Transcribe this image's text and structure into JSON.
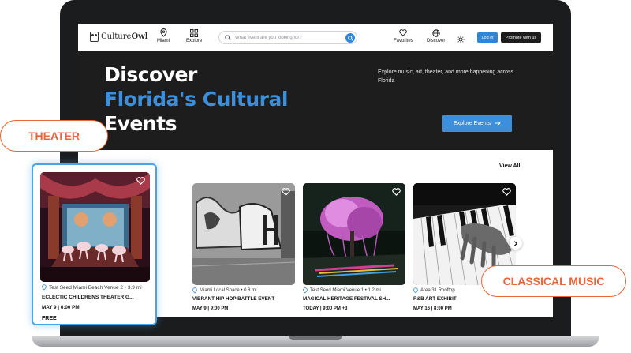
{
  "brand": {
    "prefix": "Culture",
    "suffix": "Owl"
  },
  "nav": {
    "location_label": "Miami",
    "explore_label": "Explore",
    "search_placeholder": "What event are you looking for?",
    "favorites_label": "Favorites",
    "discover_label": "Discover",
    "login_label": "Log in",
    "promote_label": "Promote with us"
  },
  "hero": {
    "line1": "Discover",
    "line2": "Florida's Cultural",
    "line3": "Events",
    "subtitle": "Explore music, art, theater, and more happening across Florida",
    "cta_label": "Explore Events",
    "accent_color": "#3b8fdc"
  },
  "events": {
    "view_all_label": "View All",
    "featured": {
      "venue": "Test Seed Miami Beach Venue 2 • 3.9 mi",
      "title": "ECLECTIC CHILDRENS THEATER G...",
      "date": "MAY 9  |  6:00 PM",
      "price": "FREE"
    },
    "cards": [
      {
        "venue": "Miami Local Space • 0.8 mi",
        "title": "VIBRANT HIP HOP BATTLE EVENT",
        "date": "MAY 9  |  9:00 PM"
      },
      {
        "venue": "Test Seed Miami Venue 1 • 1.2 mi",
        "title": "MAGICAL HERITAGE FESTIVAL SH...",
        "date": "TODAY  |  9:00 PM  +3"
      },
      {
        "venue": "Area 31 Rooftop",
        "title": "R&B ART EXHIBIT",
        "date": "MAY 16  |  8:00 PM"
      }
    ]
  },
  "tags": {
    "theater": "THEATER",
    "classical": "CLASSICAL MUSIC",
    "color": "#e9653b"
  }
}
